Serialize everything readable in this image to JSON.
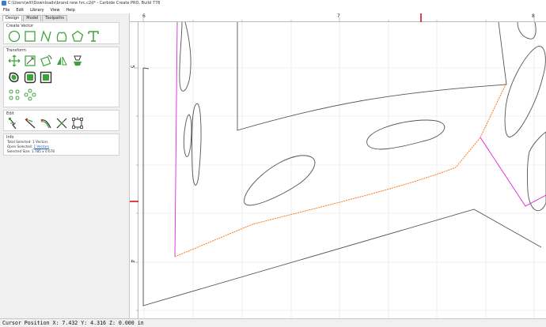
{
  "window": {
    "title": "C:\\Users\\will\\Downloads\\brand new hrc.c2d* - Carbide Create PRO, Build 778"
  },
  "menubar": {
    "items": [
      "File",
      "Edit",
      "Library",
      "View",
      "Help"
    ]
  },
  "panel": {
    "tabs": [
      "Design",
      "Model",
      "Toolpaths"
    ],
    "active_tab": "Design",
    "create_vector": {
      "header": "Create Vector",
      "tools": [
        "circle-icon",
        "rectangle-icon",
        "polyline-icon",
        "curve-icon",
        "polygon-icon",
        "text-icon"
      ]
    },
    "transform": {
      "header": "Transform",
      "tools": [
        "move-icon",
        "scale-icon",
        "rotate-icon",
        "mirror-icon",
        "align-icon",
        "offset-icon",
        "inset-icon",
        "boolean-icon"
      ]
    },
    "array_tools": [
      "linear-array-icon",
      "circular-array-icon"
    ],
    "edit": {
      "header": "Edit",
      "tools": [
        "node-edit-icon",
        "trim-icon",
        "join-icon",
        "cut-icon",
        "bounding-box-icon"
      ]
    },
    "info": {
      "header": "Info",
      "total_selected_label": "Total Selected:",
      "total_selected_value": "1 Vectors",
      "open_selected_label": "Open Selected:",
      "open_selected_value": "1 Vectors",
      "selected_size_label": "Selected Size:",
      "selected_size_value": "1.785 x 0.678"
    }
  },
  "rulers": {
    "horizontal_labels": [
      "6",
      "7",
      "8"
    ],
    "vertical_labels": [
      "5",
      "4"
    ]
  },
  "colors": {
    "accent_green": "#3aa33a",
    "selected_orange": "#ff6a00",
    "magenta_path": "#e020e0",
    "ruler_marker": "#d40000"
  },
  "status": {
    "text": "Cursor Position X: 7.432 Y: 4.316 Z: 0.000 in"
  }
}
